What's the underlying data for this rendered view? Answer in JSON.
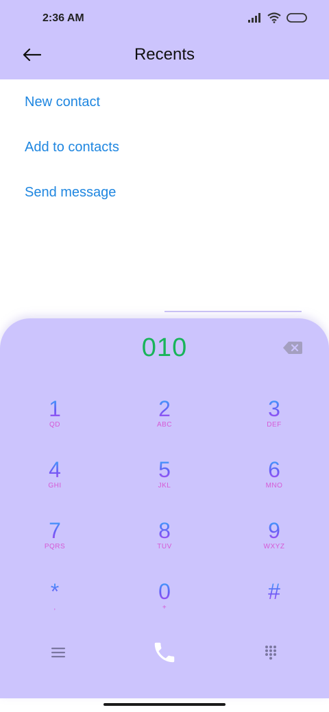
{
  "status_bar": {
    "time": "2:36 AM",
    "icons": [
      "signal-icon",
      "wifi-icon",
      "battery-icon"
    ]
  },
  "app_bar": {
    "title": "Recents",
    "back_icon": "back-arrow-icon"
  },
  "options": [
    {
      "label": "New contact"
    },
    {
      "label": "Add to contacts"
    },
    {
      "label": "Send message"
    }
  ],
  "dialpad": {
    "number": "010",
    "backspace_icon": "backspace-icon",
    "keys": [
      {
        "digit": "1",
        "letters": "QD"
      },
      {
        "digit": "2",
        "letters": "ABC"
      },
      {
        "digit": "3",
        "letters": "DEF"
      },
      {
        "digit": "4",
        "letters": "GHI"
      },
      {
        "digit": "5",
        "letters": "JKL"
      },
      {
        "digit": "6",
        "letters": "MNO"
      },
      {
        "digit": "7",
        "letters": "PQRS"
      },
      {
        "digit": "8",
        "letters": "TUV"
      },
      {
        "digit": "9",
        "letters": "WXYZ"
      },
      {
        "digit": "*",
        "letters": ","
      },
      {
        "digit": "0",
        "letters": "+"
      },
      {
        "digit": "#",
        "letters": ""
      }
    ]
  },
  "bottom_bar": {
    "menu_icon": "menu-icon",
    "call_icon": "phone-call-icon",
    "keypad_icon": "dialpad-grid-icon"
  },
  "colors": {
    "header_bg": "#ccc4fd",
    "link": "#1e86e0",
    "number": "#19b45a",
    "letters": "#d65ad6"
  }
}
